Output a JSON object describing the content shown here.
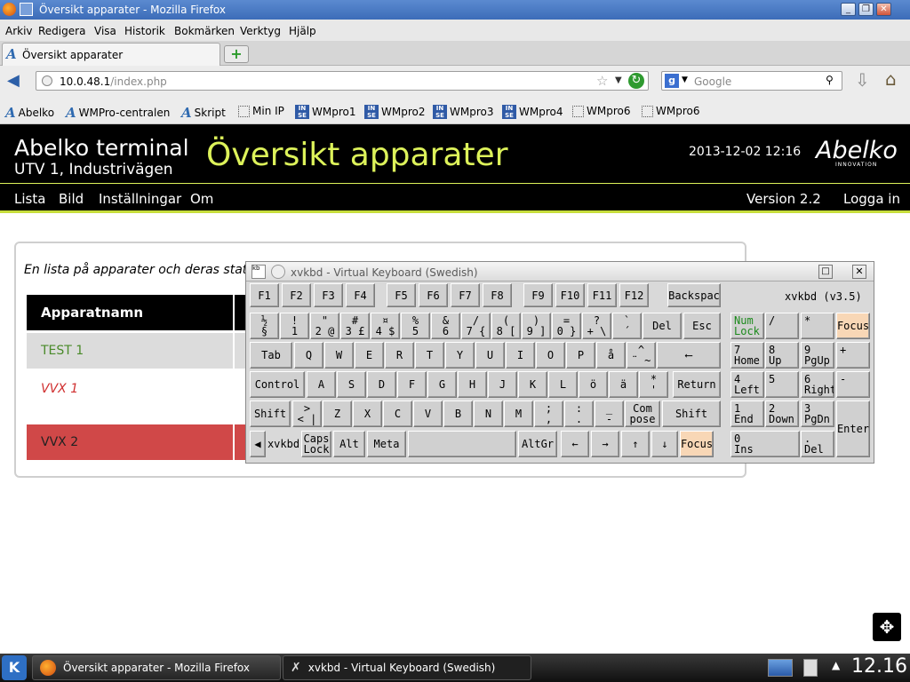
{
  "window": {
    "title": "Översikt apparater - Mozilla Firefox"
  },
  "menu": [
    "Arkiv",
    "Redigera",
    "Visa",
    "Historik",
    "Bokmärken",
    "Verktyg",
    "Hjälp"
  ],
  "tab": {
    "label": "Översikt apparater"
  },
  "nav": {
    "url_host": "10.0.48.1",
    "url_path": "/index.php",
    "search_placeholder": "Google"
  },
  "bookmarks": [
    "Abelko",
    "WMPro-centralen",
    "Skript",
    "Min IP",
    "WMpro1",
    "WMpro2",
    "WMpro3",
    "WMpro4",
    "WMpro6",
    "WMpro6"
  ],
  "app": {
    "title": "Abelko terminal",
    "subtitle": "UTV 1, Industrivägen",
    "page_title": "Översikt apparater",
    "datetime": "2013-12-02 12:16",
    "logo": "Abelko",
    "logo_sub": "INNOVATION",
    "nav": [
      "Lista",
      "Bild",
      "Inställningar",
      "Om"
    ],
    "version": "Version 2.2",
    "login": "Logga in",
    "intro": "En lista på apparater och deras statu",
    "table_header": "Apparatnamn",
    "rows": [
      {
        "name": "TEST 1",
        "bg": "#dcdcdc",
        "color": "#4a8a2a"
      },
      {
        "name": "VVX 1",
        "bg": "#ffffff",
        "color": "#d03030"
      },
      {
        "name": "VVX 2",
        "bg": "#d04848",
        "color": "#222222"
      }
    ]
  },
  "keyboard": {
    "title": "xvkbd - Virtual Keyboard (Swedish)",
    "version": "xvkbd (v3.5)",
    "fkeys": [
      "F1",
      "F2",
      "F3",
      "F4",
      "F5",
      "F6",
      "F7",
      "F8",
      "F9",
      "F10",
      "F11",
      "F12"
    ],
    "backspace": "Backspac",
    "row1": [
      "½\n§",
      "!\n1",
      "\"\n2 @",
      "#\n3 £",
      "¤\n4 $",
      "%\n5",
      "&\n6",
      "/\n7 {",
      "(\n8 [",
      ")\n9 ]",
      "=\n0 }",
      "?\n+ \\",
      "`\n´"
    ],
    "del": "Del",
    "esc": "Esc",
    "tab": "Tab",
    "row2": [
      "Q",
      "W",
      "E",
      "R",
      "T",
      "Y",
      "U",
      "I",
      "O",
      "P",
      "å",
      "^\n¨ ~"
    ],
    "enter_arrow": "⟵",
    "control": "Control",
    "row3": [
      "A",
      "S",
      "D",
      "F",
      "G",
      "H",
      "J",
      "K",
      "L",
      "ö",
      "ä",
      "*\n'"
    ],
    "return": "Return",
    "shift": "Shift",
    "row4": [
      ">\n< |",
      "Z",
      "X",
      "C",
      "V",
      "B",
      "N",
      "M",
      ";\n,",
      ":\n.",
      "_\n-"
    ],
    "compose": "Com\npose",
    "row5": {
      "caps": "Caps\nLock",
      "alt": "Alt",
      "meta": "Meta",
      "altgr": "AltGr",
      "left": "←",
      "right": "→",
      "up": "↑",
      "down": "↓",
      "focus": "Focus"
    },
    "numpad": {
      "numlock": "Num\nLock",
      "div": "/",
      "mul": "*",
      "focus": "Focus",
      "n7": "7\nHome",
      "n8": "8\nUp",
      "n9": "9\nPgUp",
      "plus": "+",
      "n4": "4\nLeft",
      "n5": "5",
      "n6": "6\nRight",
      "minus": "-",
      "n1": "1\nEnd",
      "n2": "2\nDown",
      "n3": "3\nPgDn",
      "enter": "Enter",
      "n0": "0\nIns",
      "dot": ".\nDel"
    }
  },
  "taskbar": {
    "tasks": [
      "Översikt apparater - Mozilla Firefox",
      "xvkbd - Virtual Keyboard (Swedish)"
    ],
    "clock": "12.16"
  }
}
